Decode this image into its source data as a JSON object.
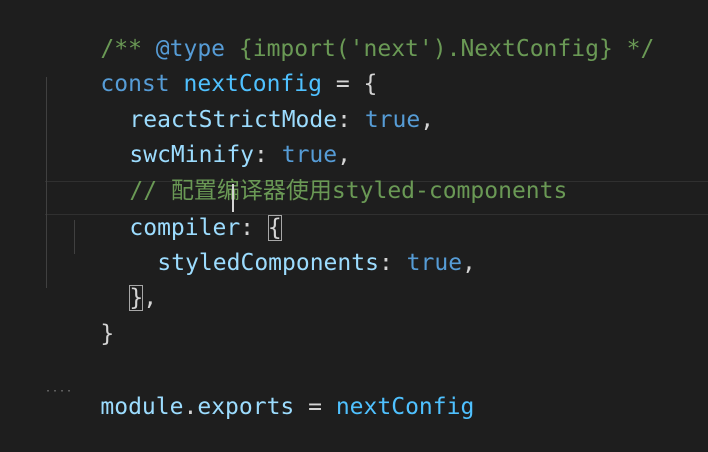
{
  "editor": {
    "lines": [
      {
        "tokens": [
          "/** ",
          "@type",
          " {import('",
          "next",
          "').",
          "NextConfig",
          "} */"
        ]
      },
      {
        "tokens": [
          "const",
          " ",
          "nextConfig",
          " = {"
        ]
      },
      {
        "tokens": [
          "reactStrictMode",
          ": ",
          "true",
          ","
        ]
      },
      {
        "tokens": [
          "swcMinify",
          ": ",
          "true",
          ","
        ]
      },
      {
        "tokens": [
          "// 配置编译器使用styled-components"
        ]
      },
      {
        "tokens": [
          "compiler",
          ": ",
          "{"
        ]
      },
      {
        "tokens": [
          "styledComponents",
          ": ",
          "true",
          ","
        ]
      },
      {
        "tokens": [
          "}",
          ","
        ]
      },
      {
        "tokens": [
          "}"
        ]
      },
      {
        "tokens": []
      },
      {
        "tokens": [
          "module",
          ".",
          "exports",
          " = ",
          "nextConfig"
        ]
      }
    ],
    "squiggle_marker": "····"
  },
  "colors": {
    "background": "#1e1e1e",
    "comment": "#6a9955",
    "keyword": "#569cd6",
    "variable": "#9cdcfe",
    "plain": "#d4d4d4",
    "string": "#ce9178",
    "type": "#4ec9b0"
  }
}
